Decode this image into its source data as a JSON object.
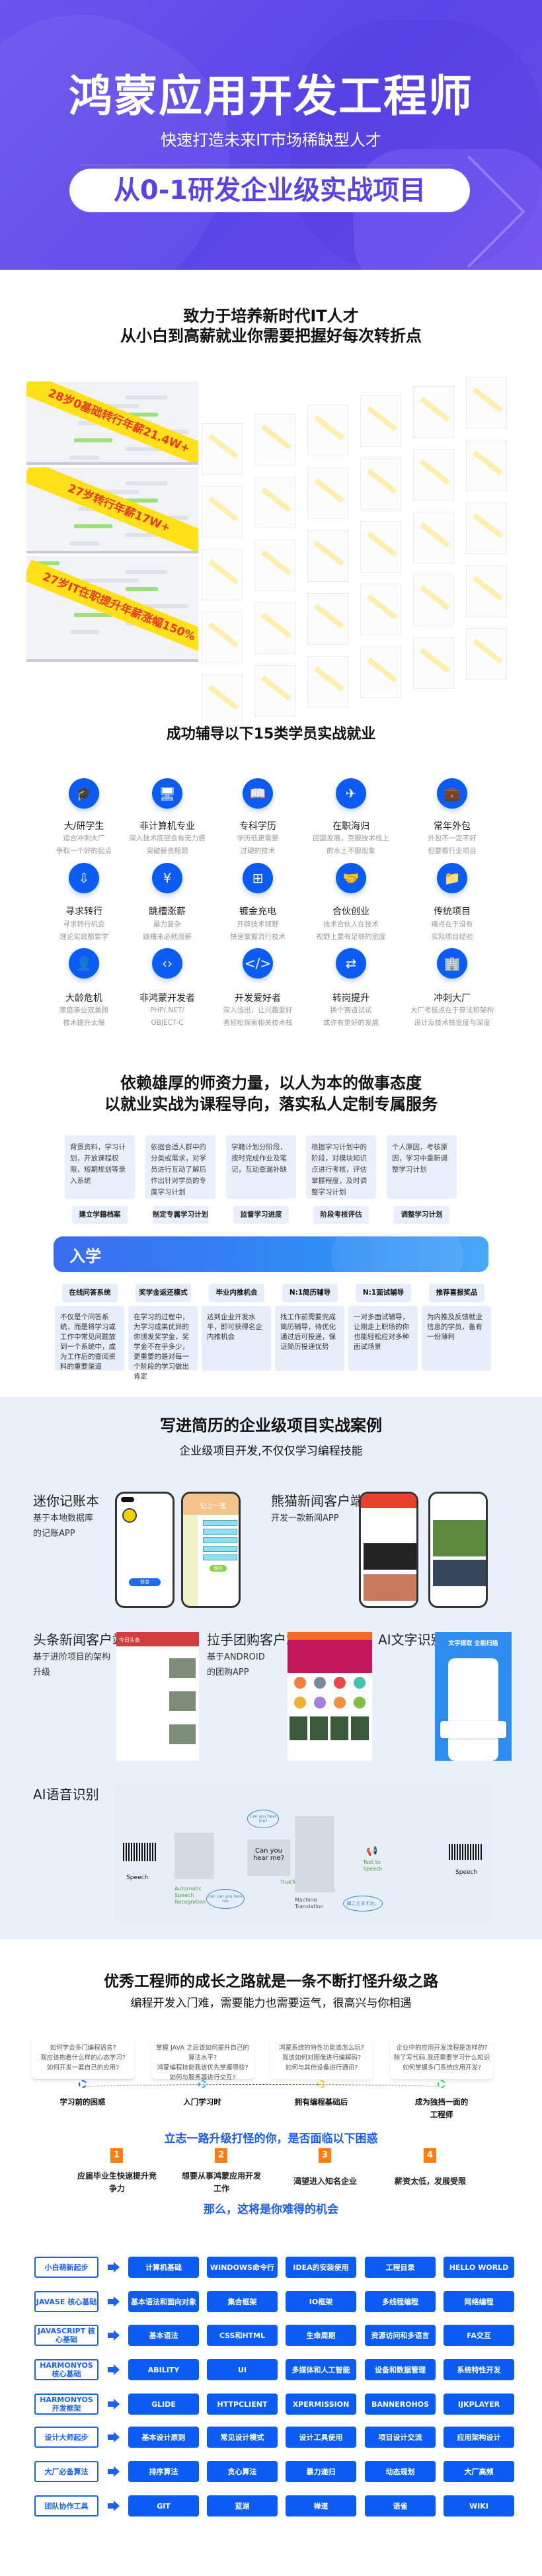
{
  "hero": {
    "title": "鸿蒙应用开发工程师",
    "subtitle": "快速打造未来IT市场稀缺型人才",
    "pill": "从0-1研发企业级实战项目",
    "bg_color": "#5a45e8"
  },
  "talent": {
    "line1": "致力于培养新时代IT人才",
    "line2": "从小白到高薪就业你需要把握好每次转折点",
    "banners": [
      "28岁0基础转行年薪21.4W+",
      "27岁转行年薪17W+",
      "27岁IT在职提升年薪涨幅150%"
    ]
  },
  "students": {
    "title": "成功辅导以下15类学员实战就业",
    "accent": "#0b5cf5",
    "items": [
      {
        "icon": "graduation-cap-icon",
        "glyph": "🎓",
        "title": "大/研学生",
        "desc": [
          "适合冲刺大厂",
          "争取一个好的起点"
        ]
      },
      {
        "icon": "monitor-icon",
        "glyph": "🖥",
        "title": "非计算机专业",
        "desc": [
          "深入技术底层会有无力感",
          "突破薪资瓶颈"
        ]
      },
      {
        "icon": "book-icon",
        "glyph": "📖",
        "title": "专科学历",
        "desc": [
          "学历低更需要",
          "过硬的技术"
        ]
      },
      {
        "icon": "globe-plane-icon",
        "glyph": "✈",
        "title": "在职海归",
        "desc": [
          "回国发展，克服技术栈上",
          "的水土不服现象"
        ]
      },
      {
        "icon": "briefcase-icon",
        "glyph": "💼",
        "title": "常年外包",
        "desc": [
          "外包不一定不好",
          "但要看行业项目"
        ]
      },
      {
        "icon": "transfer-icon",
        "glyph": "⇩",
        "title": "寻求转行",
        "desc": [
          "寻求转行机会",
          "理论实践都要学"
        ]
      },
      {
        "icon": "yuan-icon",
        "glyph": "¥",
        "title": "跳槽涨薪",
        "desc": [
          "最为复杂",
          "跳槽未必就涨薪"
        ]
      },
      {
        "icon": "charge-icon",
        "glyph": "⊞",
        "title": "镀金充电",
        "desc": [
          "开辟技术视野",
          "快速掌握流行技术"
        ]
      },
      {
        "icon": "handshake-icon",
        "glyph": "🤝",
        "title": "合伙创业",
        "desc": [
          "技术合伙人在技术",
          "视野上要有足够的宽度"
        ]
      },
      {
        "icon": "folder-icon",
        "glyph": "📁",
        "title": "传统项目",
        "desc": [
          "痛点在于没有",
          "实际项目经验"
        ]
      },
      {
        "icon": "person-hat-icon",
        "glyph": "👤",
        "title": "大龄危机",
        "desc": [
          "家庭事业双兼顾",
          "技术提升太慢"
        ]
      },
      {
        "icon": "code-window-icon",
        "glyph": "‹›",
        "title": "非鸿蒙开发者",
        "desc": [
          "PHP/.NET/",
          "OBJECT-C"
        ]
      },
      {
        "icon": "developer-icon",
        "glyph": "</>",
        "title": "开发爱好者",
        "desc": [
          "深入浅出，让兴趣爱好",
          "者轻松探索相关技术栈"
        ]
      },
      {
        "icon": "user-switch-icon",
        "glyph": "⇄",
        "title": "转岗提升",
        "desc": [
          "换个赛道试试",
          "或许有更好的发展"
        ]
      },
      {
        "icon": "building-icon",
        "glyph": "🏢",
        "title": "冲刺大厂",
        "desc": [
          "大厂考核点在于算法和架构",
          "设计及技术栈宽度与深度"
        ]
      }
    ]
  },
  "service": {
    "line1": "依赖雄厚的师资力量，以人为本的做事态度",
    "line2": "以就业实战为课程导向，落实私人定制专属服务",
    "steps": [
      {
        "text": "背景资料，学习计划，开放课程权限，短期规划等录入系统",
        "label": "建立学籍档案"
      },
      {
        "text": "依据合适人群中的分类或需求，对学员进行互动了解后作出针对学员的专属学习计划",
        "label": "制定专属学习计划"
      },
      {
        "text": "学籍计划分阶段，按时完成作业及笔记，互动查漏补缺",
        "label": "监督学习进度"
      },
      {
        "text": "根据学习计划中的阶段，对模块知识点进行考核，评估掌握程度，及时调整学习计划",
        "label": "阶段考核评估"
      },
      {
        "text": "个人原因，考核原因，学习中重新调整学习计划",
        "label": "调整学习计划"
      }
    ]
  },
  "enroll": {
    "title": "入学",
    "items": [
      {
        "tag": "在线问答系统",
        "text": "不仅是个问答系统，而是将学习或工作中常见问题放到一个系统中，成为工作后的查阅资料的重要渠道"
      },
      {
        "tag": "奖学金返还模式",
        "text": "在学习的过程中，为学习成果优异的你颁发奖学金，奖学金不在乎多少，更重要的是对每一个阶段的学习做出肯定"
      },
      {
        "tag": "毕业内推机会",
        "text": "达到企业开发水平，即可获得名企内推机会"
      },
      {
        "tag": "N:1简历辅导",
        "text": "找工作前需要完成简历辅导，待优化通过后可投递，保证简历投递优势"
      },
      {
        "tag": "N:1面试辅导",
        "text": "一对多面试辅导，让刚走上职场的你也能轻松应对多种面试场景"
      },
      {
        "tag": "推荐喜报奖品",
        "text": "为内推及反馈就业信息的学员，备有一份薄利"
      }
    ]
  },
  "projects": {
    "title": "写进简历的企业级项目实战案例",
    "subtitle": "企业级项目开发,不仅仅学习编程技能",
    "items": [
      {
        "name": "迷你记账本",
        "desc": [
          "基于本地数据库",
          "的记账APP"
        ]
      },
      {
        "name": "熊猫新闻客户端",
        "desc": [
          "开发一款新闻APP"
        ]
      },
      {
        "name": "头条新闻客户端",
        "desc": [
          "基于进阶项目的架构",
          "升级"
        ]
      },
      {
        "name": "拉手团购客户端",
        "desc": [
          "基于ANDROID",
          "的团购APP"
        ]
      },
      {
        "name": "AI文字识别",
        "desc": []
      },
      {
        "name": "AI语音识别",
        "desc": []
      }
    ],
    "phone_text": {
      "save": "保存",
      "record": "记上一笔",
      "login": "登录",
      "toutiao": "今日头条",
      "ocr": "文字提取 全能扫描"
    },
    "diagram": {
      "speech_in": "Speech",
      "asr": "Automatic Speech Recognition",
      "asr_bubble": "can can you here me",
      "truetext_bubble": "Can you hear me?",
      "truetext_card": "Can you hear me?",
      "truetext": "TrueText",
      "mt": "Machine Translation",
      "mt_out": "聞こえますか。",
      "tts": "Text to Speech",
      "speech_out": "Speech"
    }
  },
  "growth": {
    "title": "优秀工程师的成长之路就是一条不断打怪升级之路",
    "subtitle": "编程开发入门难，需要能力也需要运气，很高兴与你相遇",
    "stages": [
      {
        "questions": [
          "如何学会多门编程语言?",
          "我应该抱着什么样的心态学习?",
          "如何开发一套自己的应用?"
        ],
        "label": "学习前的困惑",
        "color": "#1a5cf5"
      },
      {
        "questions": [
          "掌握 JAVA 之后该如何提升自己的",
          "算法水平?",
          "鸿蒙编程技能我该优先掌握哪些?",
          "如何与服务器进行交互?"
        ],
        "label": "入门学习时",
        "color": "#1fb5f0"
      },
      {
        "questions": [
          "鸿蒙系统的特性功能该怎么玩?",
          "我该如何对图像进行编解码?",
          "如何与其他设备进行通讯?"
        ],
        "label": "拥有编程基础后",
        "color": "#f5c400"
      },
      {
        "questions": [
          "企业中的应用开发流程是怎样的?",
          "除了写代码,我还需要学习什么知识",
          "如何掌握多门系统应用开发?"
        ],
        "label": "成为独挡一面的工程师",
        "color": "#2fd14a"
      }
    ],
    "question_title": "立志一路升级打怪的你，是否面临以下困惑",
    "problems": [
      {
        "num": "1",
        "text": "应届毕业生快速提升竞争力"
      },
      {
        "num": "2",
        "text": "想要从事鸿蒙应用开发工作"
      },
      {
        "num": "3",
        "text": "渴望进入知名企业"
      },
      {
        "num": "4",
        "text": "薪资太低，发展受限"
      }
    ],
    "closing": "那么，这将是你难得的机会"
  },
  "curriculum": [
    {
      "stage": "小白萌新起步",
      "items": [
        "计算机基础",
        "WINDOWS命令行",
        "IDEA的安装使用",
        "工程目录",
        "HELLO WORLD"
      ]
    },
    {
      "stage": "JAVASE 核心基础",
      "items": [
        "基本语法和面向对象",
        "集合框架",
        "IO框架",
        "多线程编程",
        "网络编程"
      ]
    },
    {
      "stage": "JAVASCRIPT 核心基础",
      "items": [
        "基本语法",
        "CSS和HTML",
        "生命周期",
        "资源访问和多语言",
        "FA交互"
      ]
    },
    {
      "stage": "HARMONYOS 核心基础",
      "items": [
        "ABILITY",
        "UI",
        "多媒体和人工智能",
        "设备和数据管理",
        "系统特性开发"
      ]
    },
    {
      "stage": "HARMONYOS 开发框架",
      "items": [
        "GLIDE",
        "HTTPCLIENT",
        "XPERMISSION",
        "BANNEROHOS",
        "IJKPLAYER"
      ]
    },
    {
      "stage": "设计大师起步",
      "items": [
        "基本设计原则",
        "常见设计模式",
        "设计工具使用",
        "项目设计交流",
        "应用架构设计"
      ]
    },
    {
      "stage": "大厂必备算法",
      "items": [
        "排序算法",
        "贪心算法",
        "暴力递归",
        "动态规划",
        "大厂高频"
      ]
    },
    {
      "stage": "团队协作工具",
      "items": [
        "GIT",
        "蓝湖",
        "禅道",
        "语雀",
        "WIKI"
      ]
    }
  ]
}
